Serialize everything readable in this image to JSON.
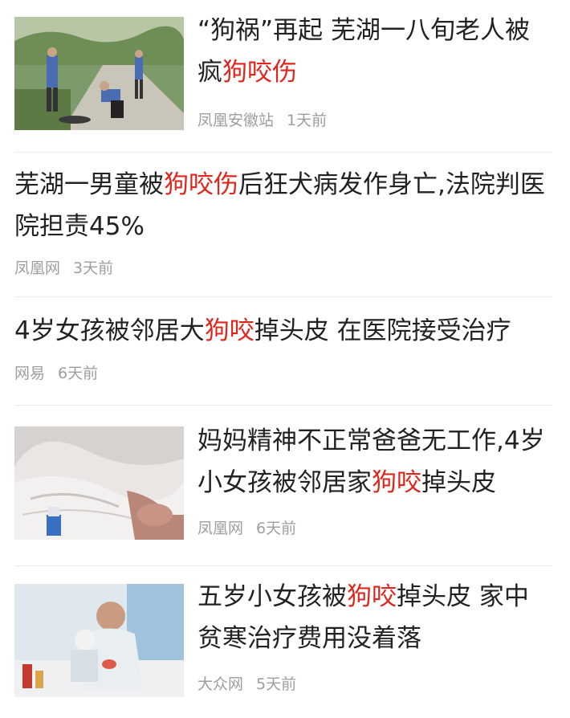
{
  "colors": {
    "headline": "#222222",
    "highlight": "#e0261c",
    "meta": "#9e9e9e",
    "divider": "#ececec"
  },
  "items": [
    {
      "headline_pre": "“狗祸”再起 芜湖一八旬老人被疯",
      "headline_hl": "狗咬伤",
      "headline_post": "",
      "source": "凤凰安徽站",
      "time": "1天前"
    },
    {
      "headline_pre": "芜湖一男童被",
      "headline_hl": "狗咬伤",
      "headline_post": "后狂犬病发作身亡,法院判医院担责45%",
      "source": "凤凰网",
      "time": "3天前"
    },
    {
      "headline_pre": "4岁女孩被邻居大",
      "headline_hl": "狗咬",
      "headline_post": "掉头皮 在医院接受治疗",
      "source": "网易",
      "time": "6天前"
    },
    {
      "headline_pre": "妈妈精神不正常爸爸无工作,4岁小女孩被邻居家",
      "headline_hl": "狗咬",
      "headline_post": "掉头皮",
      "source": "凤凰网",
      "time": "6天前"
    },
    {
      "headline_pre": "五岁小女孩被",
      "headline_hl": "狗咬",
      "headline_post": "掉头皮 家中贫寒治疗费用没着落",
      "source": "大众网",
      "time": "5天前"
    }
  ]
}
